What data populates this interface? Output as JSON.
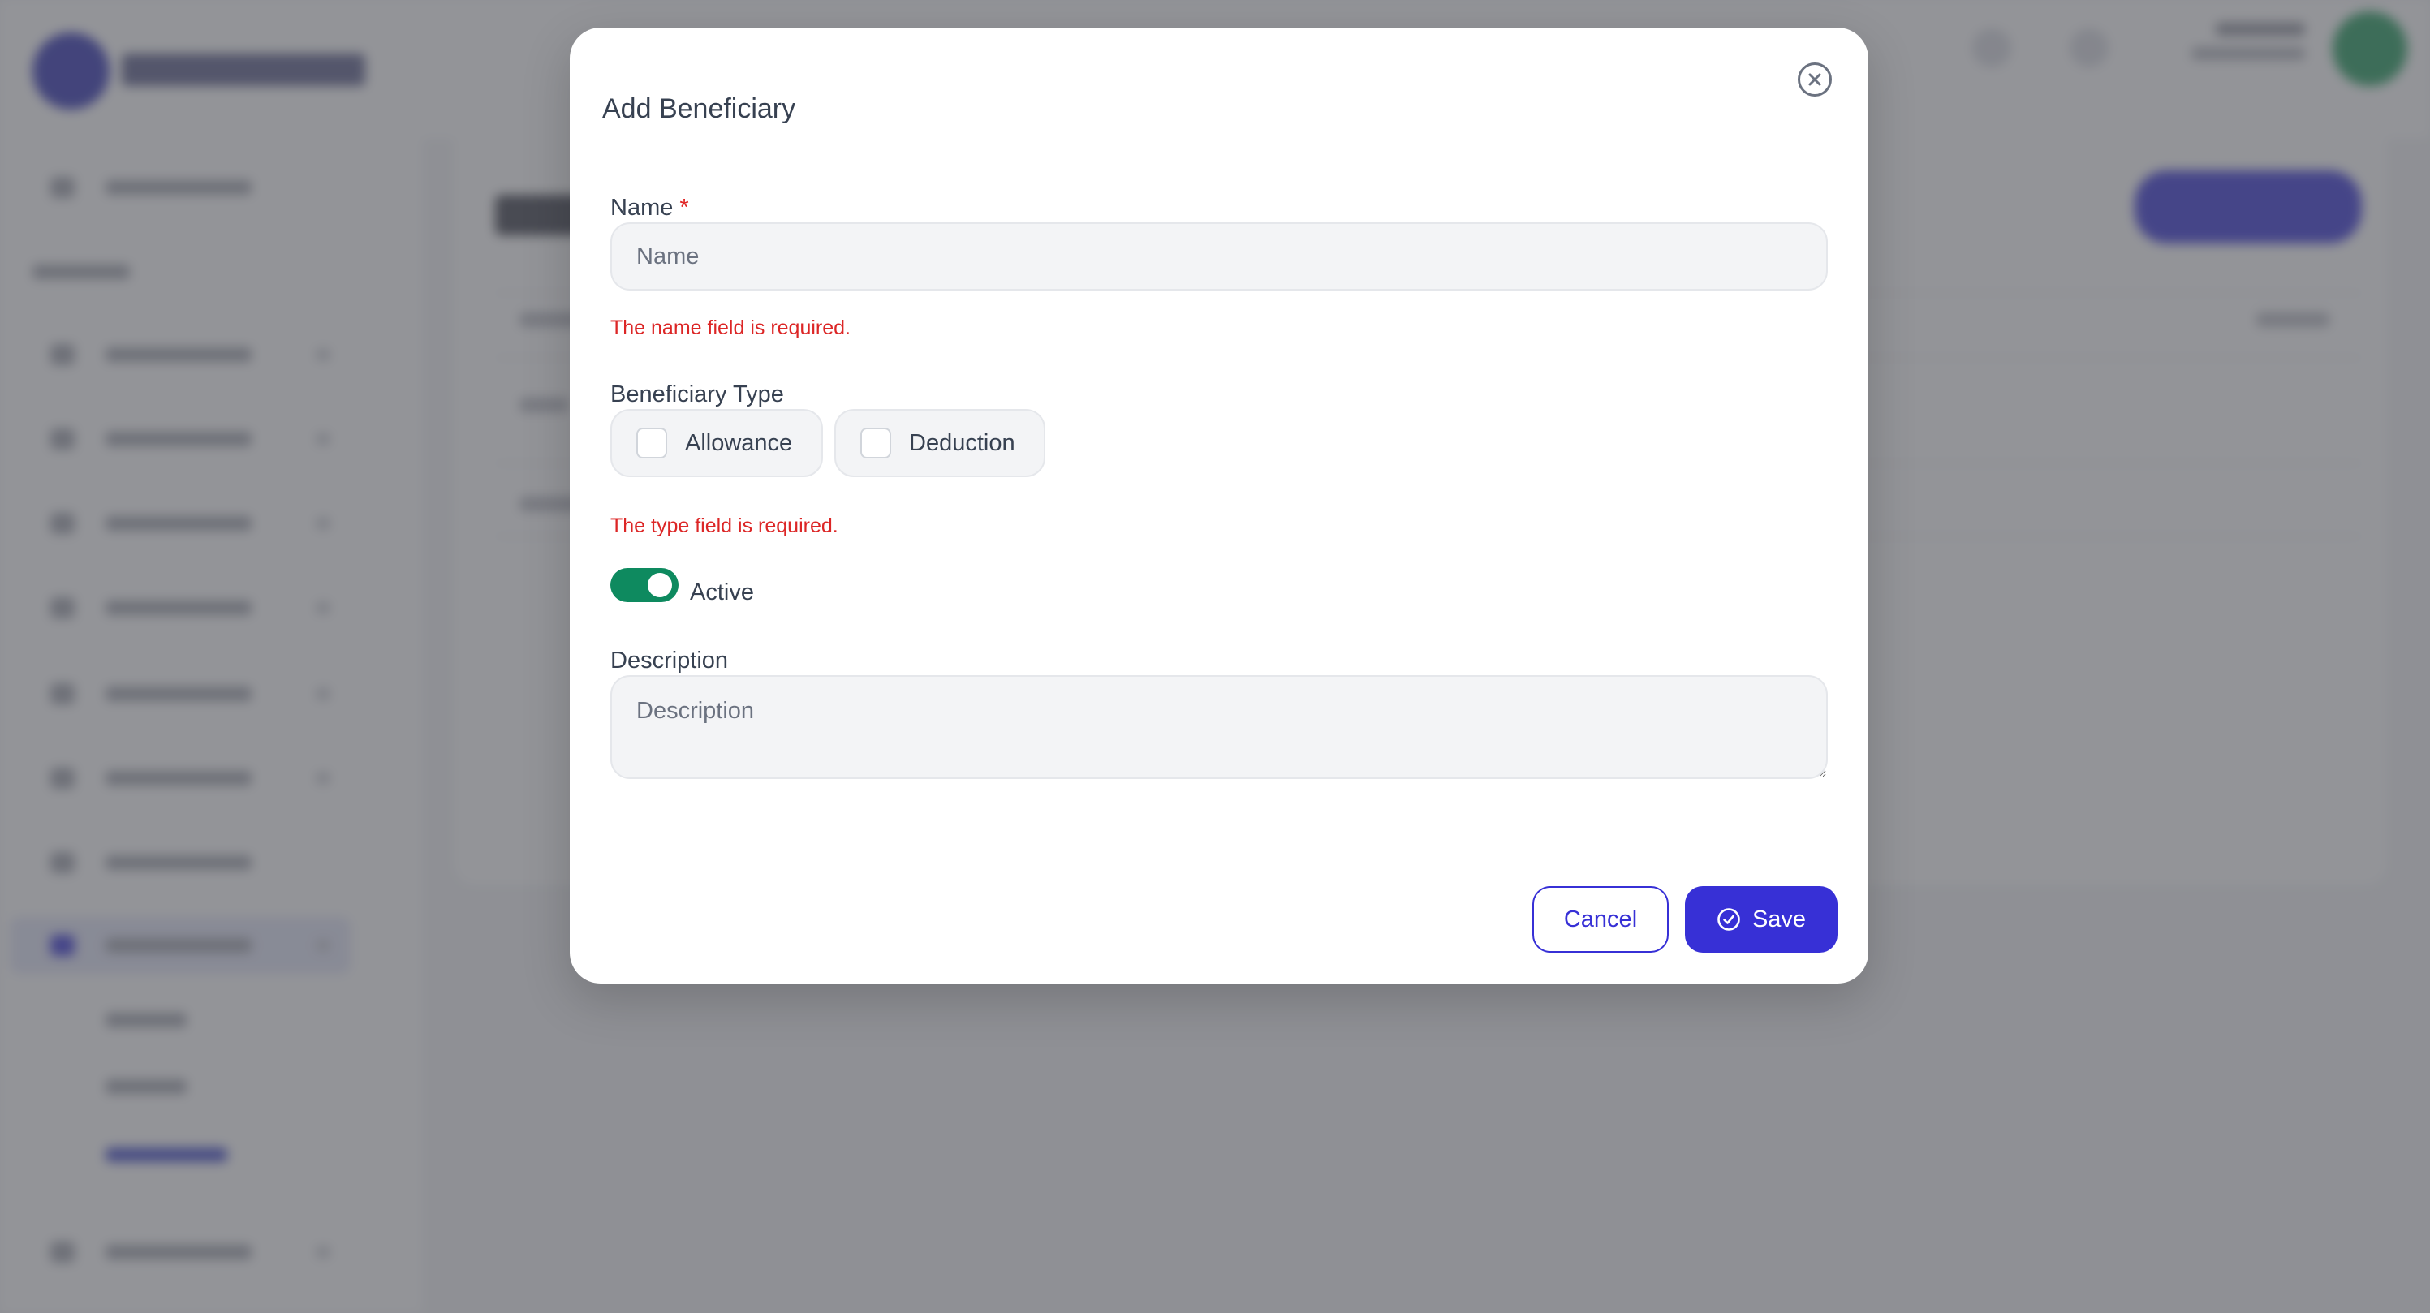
{
  "modal": {
    "title": "Add Beneficiary",
    "close_icon": "close-circle-icon"
  },
  "form": {
    "name": {
      "label": "Name",
      "required_marker": "*",
      "placeholder": "Name",
      "value": "",
      "error": "The name field is required."
    },
    "beneficiary_type": {
      "label": "Beneficiary Type",
      "options": [
        {
          "label": "Allowance",
          "checked": false
        },
        {
          "label": "Deduction",
          "checked": false
        }
      ],
      "error": "The type field is required."
    },
    "active": {
      "label": "Active",
      "on": true
    },
    "description": {
      "label": "Description",
      "placeholder": "Description",
      "value": ""
    }
  },
  "actions": {
    "cancel_label": "Cancel",
    "save_label": "Save",
    "save_icon": "check-circle-icon"
  },
  "colors": {
    "primary": "#3730d6",
    "error": "#dc2626",
    "toggle_on": "#0e8a5f",
    "input_bg": "#f3f4f6",
    "overlay": "#868686"
  }
}
